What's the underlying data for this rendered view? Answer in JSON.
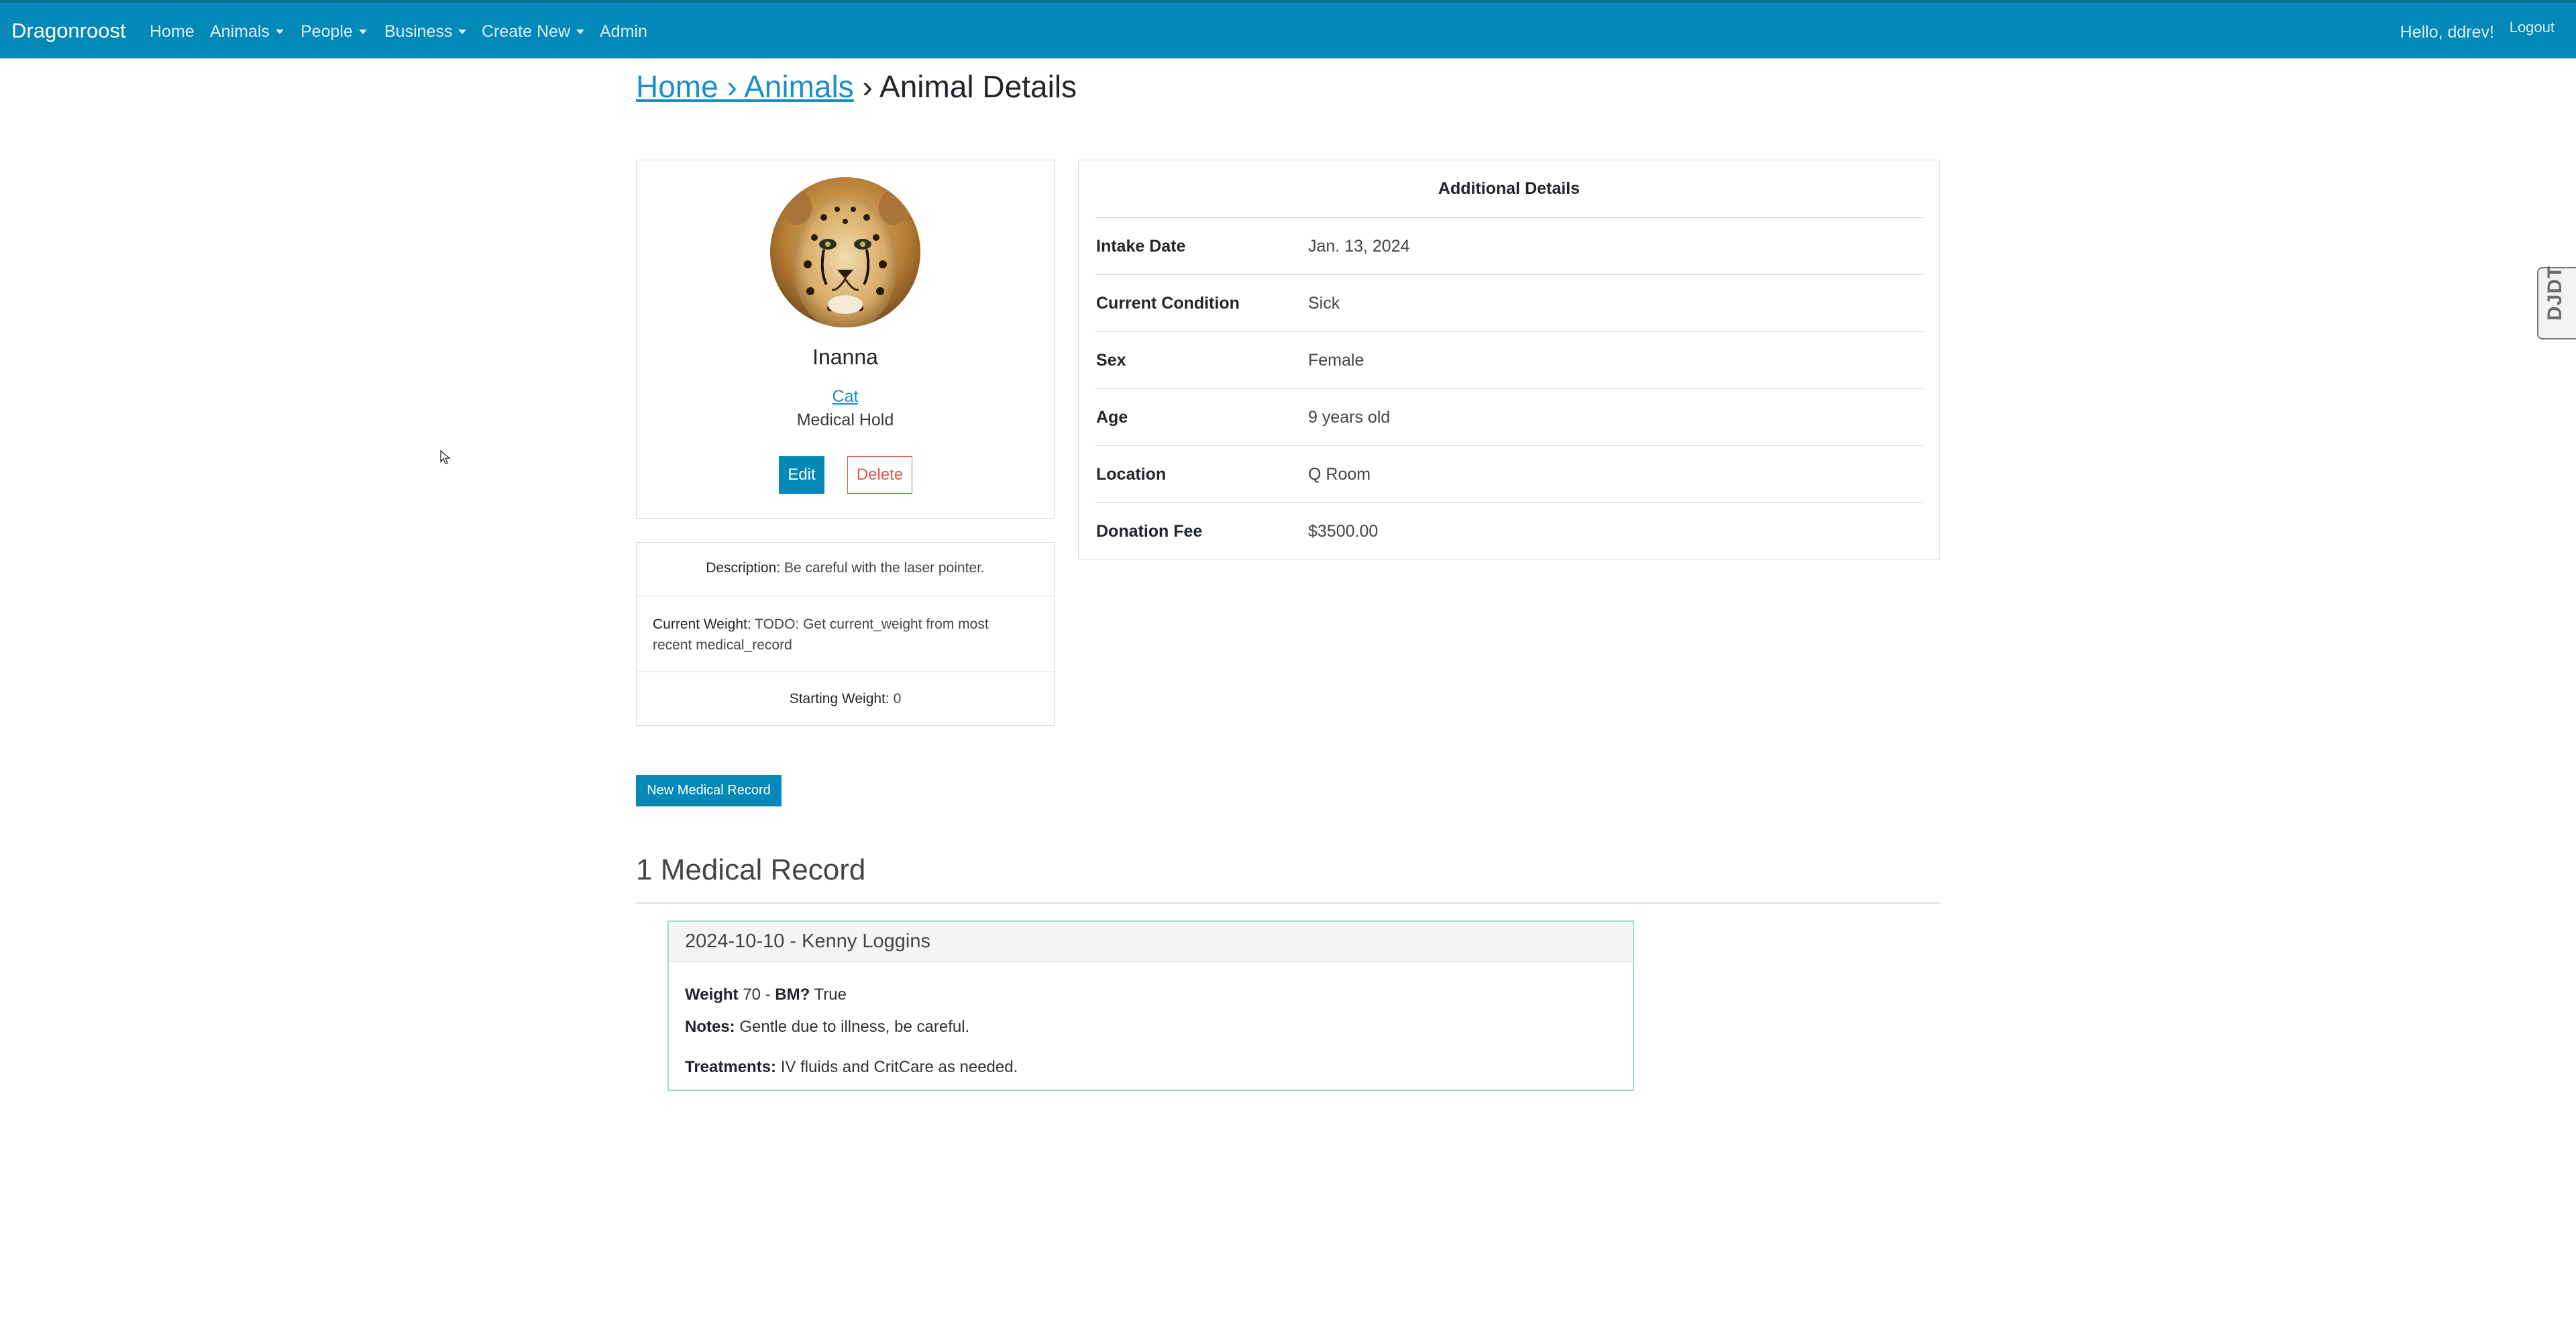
{
  "navbar": {
    "brand": "Dragonroost",
    "items": [
      {
        "label": "Home"
      },
      {
        "label": "Animals"
      },
      {
        "label": "People"
      },
      {
        "label": "Business"
      },
      {
        "label": "Create New"
      },
      {
        "label": "Admin"
      }
    ],
    "greeting": "Hello, ddrev!",
    "logout": "Logout"
  },
  "breadcrumb": {
    "home": "Home",
    "sep1": "›",
    "animals": "Animals",
    "sep2": "›",
    "current": "Animal Details"
  },
  "profile": {
    "name": "Inanna",
    "species": "Cat",
    "status": "Medical Hold",
    "edit_label": "Edit",
    "delete_label": "Delete"
  },
  "info": {
    "description_label": "Description:",
    "description": "Be careful with the laser pointer.",
    "current_weight_label": "Current Weight:",
    "current_weight_line1": "TODO: Get current_weight from most",
    "current_weight_line2": "recent medical_record",
    "starting_weight_label": "Starting Weight:",
    "starting_weight": "0"
  },
  "details": {
    "title": "Additional Details",
    "rows": [
      {
        "label": "Intake Date",
        "value": "Jan. 13, 2024"
      },
      {
        "label": "Current Condition",
        "value": "Sick"
      },
      {
        "label": "Sex",
        "value": "Female"
      },
      {
        "label": "Age",
        "value": "9 years old"
      },
      {
        "label": "Location",
        "value": "Q Room"
      },
      {
        "label": "Donation Fee",
        "value": "$3500.00"
      }
    ]
  },
  "records": {
    "new_button": "New Medical Record",
    "heading": "1 Medical Record",
    "items": [
      {
        "header": "2024-10-10 - Kenny Loggins",
        "weight_label": "Weight",
        "weight": "70",
        "dash": "-",
        "bm_label": "BM?",
        "bm": "True",
        "notes_label": "Notes:",
        "notes": "Gentle due to illness, be careful.",
        "treatments_label": "Treatments:",
        "treatments": "IV fluids and CritCare as needed."
      }
    ]
  },
  "debug_toolbar": {
    "label": "DJDT"
  },
  "colors": {
    "navbar": "#0388b8",
    "link": "#1a8fc6",
    "danger": "#e0584a",
    "record_border": "#a8d7c8"
  }
}
